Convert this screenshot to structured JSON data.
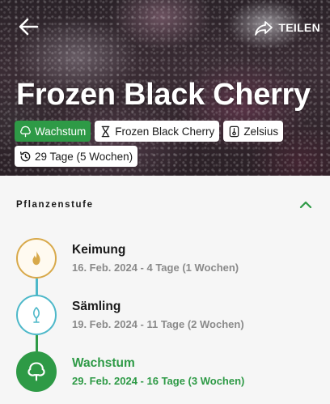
{
  "header": {
    "share_label": "TEILEN",
    "title": "Frozen Black Cherry"
  },
  "chips": [
    {
      "label": "Wachstum",
      "icon": "tree-icon",
      "active": true
    },
    {
      "label": "Frozen Black Cherry",
      "icon": "hourglass-icon",
      "active": false
    },
    {
      "label": "Zelsius",
      "icon": "thermometer-icon",
      "active": false
    },
    {
      "label": "29 Tage (5 Wochen)",
      "icon": "history-icon",
      "active": false
    }
  ],
  "section": {
    "title": "Pflanzenstufe"
  },
  "stages": [
    {
      "name": "Keimung",
      "date": "16. Feb. 2024 - 4 Tage (1 Wochen)",
      "icon": "flame-icon",
      "color": "#d8a94a"
    },
    {
      "name": "Sämling",
      "date": "19. Feb. 2024 - 11 Tage (2 Wochen)",
      "icon": "leaf-icon",
      "color": "#4db8c9"
    },
    {
      "name": "Wachstum",
      "date": "29. Feb. 2024 - 16 Tage (3 Wochen)",
      "icon": "tree-icon",
      "color": "#2e9a46"
    }
  ],
  "colors": {
    "accent": "#2e9a46",
    "germination": "#d8a94a",
    "seedling": "#4db8c9"
  }
}
